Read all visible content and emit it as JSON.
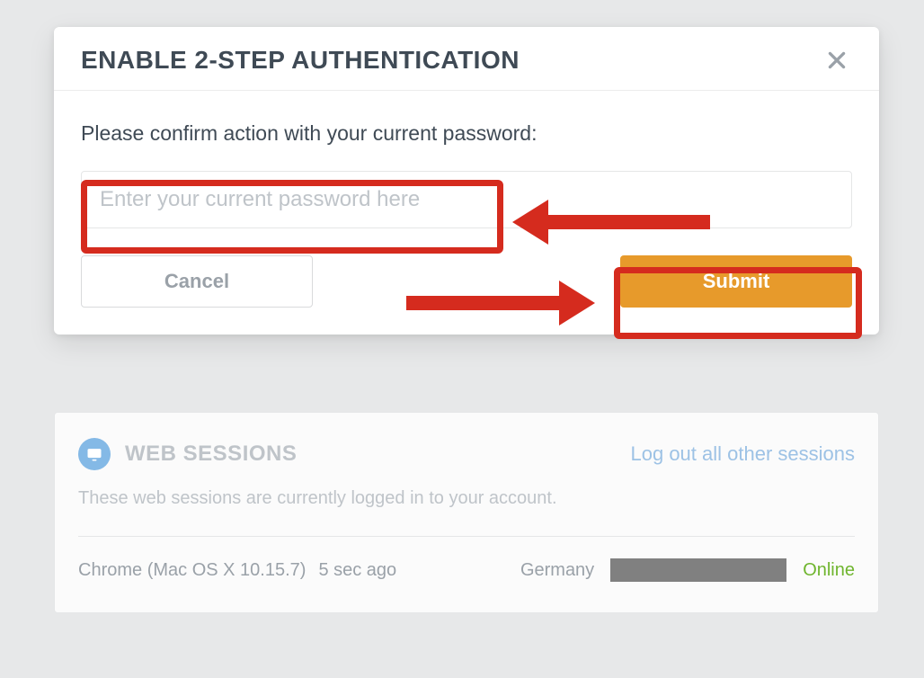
{
  "modal": {
    "title": "ENABLE 2-STEP AUTHENTICATION",
    "prompt": "Please confirm action with your current password:",
    "password_placeholder": "Enter your current password here",
    "cancel_label": "Cancel",
    "submit_label": "Submit"
  },
  "sessions": {
    "title": "WEB SESSIONS",
    "logout_all_label": "Log out all other sessions",
    "description": "These web sessions are currently logged in to your account.",
    "row": {
      "client": "Chrome (Mac OS X 10.15.7)",
      "when": "5 sec ago",
      "location": "Germany",
      "status": "Online"
    }
  }
}
